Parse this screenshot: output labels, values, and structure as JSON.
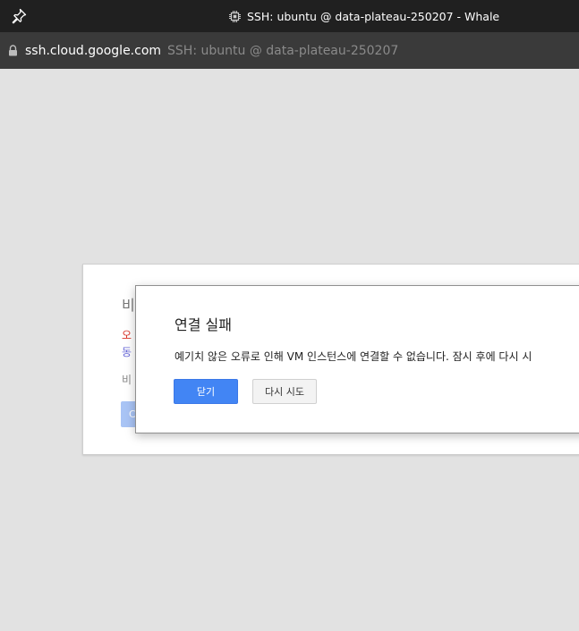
{
  "window": {
    "title": "SSH: ubuntu @ data-plateau-250207 - Whale",
    "pin_icon": "pin-icon",
    "app_icon": "chip-icon"
  },
  "address": {
    "lock_icon": "lock-icon",
    "domain": "ssh.cloud.google.com",
    "page_title": "SSH: ubuntu @ data-plateau-250207"
  },
  "background_card": {
    "heading": "비",
    "error_line": "오",
    "link_line": "동",
    "note_line": "비",
    "button_label": "C"
  },
  "dialog": {
    "title": "연결 실패",
    "message": "예기치 않은 오류로 인해 VM 인스턴스에 연결할 수 없습니다. 잠시 후에 다시 시",
    "close_button": "닫기",
    "retry_button": "다시 시도"
  },
  "colors": {
    "primary_button": "#4285f4",
    "error_text": "#d93025",
    "titlebar_bg": "#202020",
    "addressbar_bg": "#3a3a3a",
    "page_bg": "#e2e2e2"
  }
}
